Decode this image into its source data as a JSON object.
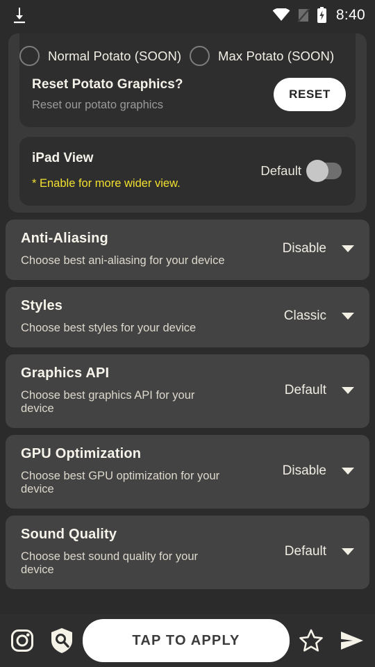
{
  "status_bar": {
    "time": "8:40",
    "icons": [
      "download-icon",
      "wifi-icon",
      "signal-off-icon",
      "battery-charging-icon"
    ]
  },
  "potato_section": {
    "radios": [
      {
        "label": "Normal Potato (SOON)",
        "selected": false
      },
      {
        "label": "Max Potato (SOON)",
        "selected": false
      }
    ],
    "reset": {
      "title": "Reset Potato  Graphics?",
      "subtitle": "Reset our potato graphics",
      "button_label": "RESET"
    }
  },
  "ipad_view": {
    "title": "iPad View",
    "warning": "* Enable for more wider view.",
    "toggle_label": "Default",
    "toggle_on": false
  },
  "settings": [
    {
      "title": "Anti-Aliasing",
      "subtitle": "Choose best ani-aliasing for your device",
      "value": "Disable"
    },
    {
      "title": "Styles",
      "subtitle": "Choose best styles for your device",
      "value": "Classic"
    },
    {
      "title": "Graphics API",
      "subtitle": "Choose best graphics API for your device",
      "value": "Default"
    },
    {
      "title": "GPU Optimization",
      "subtitle": "Choose best GPU optimization for your device",
      "value": "Disable"
    },
    {
      "title": "Sound Quality",
      "subtitle": "Choose best sound quality for your device",
      "value": "Default"
    }
  ],
  "bottom_bar": {
    "apply_label": "TAP TO APPLY",
    "left_icons": [
      "instagram-icon",
      "shield-search-icon"
    ],
    "right_icons": [
      "star-icon",
      "send-icon"
    ]
  },
  "colors": {
    "page_background": "#2b2b2b",
    "card_background": "#434343",
    "inner_card_background": "#2e2e2e",
    "group_background": "#3a3a3a",
    "accent_warning": "#f2e02f",
    "text_primary": "#f7f4eb",
    "button_white": "#ffffff"
  }
}
